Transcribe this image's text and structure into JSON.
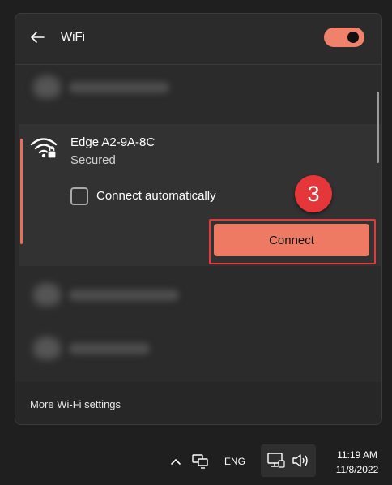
{
  "flyout": {
    "title": "WiFi",
    "toggle_on": true,
    "accent_color": "#ee7a63"
  },
  "networks": {
    "selected": {
      "name": "Edge A2-9A-8C",
      "status": "Secured",
      "auto_connect_label": "Connect automatically",
      "auto_connect_checked": false,
      "connect_label": "Connect",
      "step_badge": "3"
    }
  },
  "footer": {
    "more_settings": "More Wi-Fi settings"
  },
  "taskbar": {
    "language": "ENG",
    "time": "11:19 AM",
    "date": "11/8/2022"
  }
}
